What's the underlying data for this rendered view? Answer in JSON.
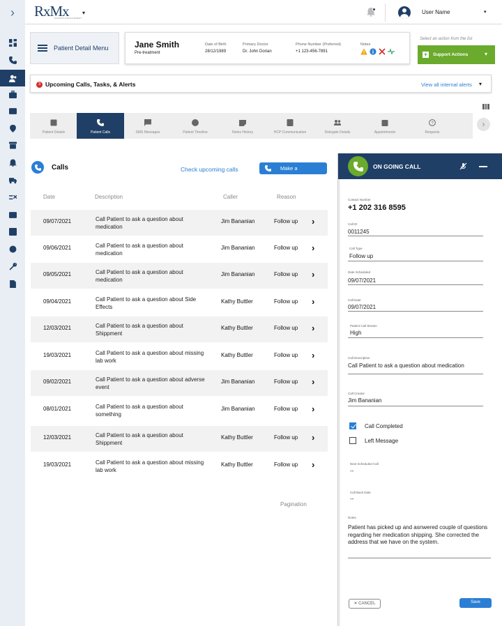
{
  "app": {
    "logo_text": "RxMx",
    "logo_subtext": "PATIENT ENGAGEMENT"
  },
  "topbar": {
    "user_name": "User Name"
  },
  "patient": {
    "menu_label": "Patient Detail Menu",
    "name": "Jane Smith",
    "status": "Pre-treatment",
    "dob_label": "Date of Birth",
    "dob": "28/12/1989",
    "doctor_label": "Primary Doctor",
    "doctor": "Dr. John Dorian",
    "phone_label": "Phone Number (Preferred)",
    "phone": "+1 123-456-7891",
    "notes_label": "Notes"
  },
  "actions": {
    "hint": "Select an action from the list",
    "support_label": "Support Actions"
  },
  "alerts": {
    "count": "3",
    "title": "Upcoming Calls, Tasks, & Alerts",
    "view_all": "View all internal alerts"
  },
  "tabs": [
    {
      "label": "Patient Details",
      "icon": "id-card-icon"
    },
    {
      "label": "Patient Calls",
      "icon": "phone-icon"
    },
    {
      "label": "SMS Messages",
      "icon": "chat-icon"
    },
    {
      "label": "Patient Timeline",
      "icon": "check-circle-icon"
    },
    {
      "label": "Notes History",
      "icon": "note-icon"
    },
    {
      "label": "HCP Communication",
      "icon": "contact-icon"
    },
    {
      "label": "Delegate Details",
      "icon": "people-icon"
    },
    {
      "label": "Appointments",
      "icon": "calendar-icon"
    },
    {
      "label": "Requests",
      "icon": "help-icon"
    }
  ],
  "active_tab": 1,
  "calls": {
    "title": "Calls",
    "check_link": "Check upcoming calls",
    "make_label": "Make a",
    "headers": {
      "date": "Date",
      "description": "Description",
      "caller": "Caller",
      "reason": "Reason"
    },
    "rows": [
      {
        "date": "09/07/2021",
        "description": "Call Patient to ask a question about medication",
        "caller": "Jim Bananian",
        "reason": "Follow up"
      },
      {
        "date": "09/06/2021",
        "description": "Call Patient to ask a question about medication",
        "caller": "Jim Bananian",
        "reason": "Follow up"
      },
      {
        "date": "09/05/2021",
        "description": "Call Patient to ask a question about medication",
        "caller": "Jim Bananian",
        "reason": "Follow up"
      },
      {
        "date": "09/04/2021",
        "description": "Call Patient to ask a question about Side Effects",
        "caller": "Kathy Buttler",
        "reason": "Follow up"
      },
      {
        "date": "12/03/2021",
        "description": "Call Patient to ask a question about Shippment",
        "caller": "Kathy Buttler",
        "reason": "Follow up"
      },
      {
        "date": "19/03/2021",
        "description": "Call Patient to ask a question about missing lab work",
        "caller": "Kathy Buttler",
        "reason": "Follow up"
      },
      {
        "date": "09/02/2021",
        "description": "Call Patient to ask a question about adverse event",
        "caller": "Jim Bananian",
        "reason": "Follow up"
      },
      {
        "date": "08/01/2021",
        "description": "Call Patient to ask a question about something",
        "caller": "Jim Bananian",
        "reason": "Follow up"
      },
      {
        "date": "12/03/2021",
        "description": "Call Patient to ask a question about Shippment",
        "caller": "Kathy Buttler",
        "reason": "Follow up"
      },
      {
        "date": "19/03/2021",
        "description": "Call Patient to ask a question about missing lab work",
        "caller": "Kathy Buttler",
        "reason": "Follow up"
      }
    ],
    "pagination": "Pagination"
  },
  "ongoing_call": {
    "title": "ON GOING CALL",
    "contact_label": "Contact Number",
    "contact_number": "+1 202 316 8595",
    "call_id_label": "Call ID",
    "call_id": "0011245",
    "call_type_label": "Call Type",
    "call_type": "Follow up",
    "date_scheduled_label": "Date Scheduled",
    "date_scheduled": "09/07/2021",
    "call_date_label": "Call Date",
    "call_date": "09/07/2021",
    "stream_label": "Patient Call Stream",
    "stream": "High",
    "description_label": "Call Description",
    "description": "Call Patient to ask a question about medication",
    "creator_label": "Call Creator",
    "creator": "Jim Bananian",
    "completed_label": "Call Completed",
    "completed": true,
    "left_message_label": "Left Message",
    "left_message": false,
    "next_scheduled_label": "Next Scheduled Call",
    "next_scheduled": "--",
    "call_back_label": "Call Back Date",
    "call_back": "--",
    "notes_label": "Notes",
    "notes": "Patient has picked up and asnwered couple of questions regarding her medication shipping. She corrected the address that we have on the system.",
    "cancel_label": "CANCEL",
    "save_label": "Save"
  },
  "colors": {
    "navy": "#1f3f66",
    "blue": "#2a7fd4",
    "green": "#6aaa2c",
    "alert_red": "#d32f2f"
  }
}
